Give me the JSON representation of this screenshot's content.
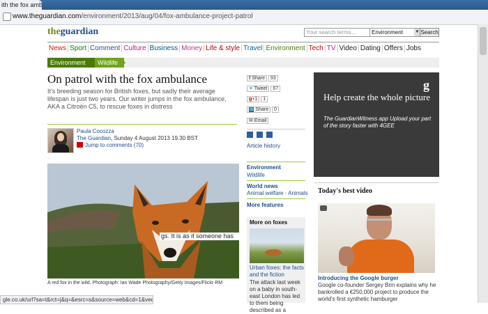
{
  "browser": {
    "tab_title": "ith the fox amb",
    "url_host": "www.theguardian.com",
    "url_path": "/environment/2013/aug/04/fox-ambulance-project-patrol",
    "status_url": "gle.co.uk/url?sa=t&rct=j&q=&esrc=s&source=web&cd=1&ved=..."
  },
  "header": {
    "logo_the": "the",
    "logo_guardian": "guardian",
    "search_placeholder": "Your search terms...",
    "search_scope": "Environment",
    "search_button": "Search"
  },
  "nav": {
    "items": [
      {
        "label": "News",
        "color": "#d61d00"
      },
      {
        "label": "Sport",
        "color": "#008000"
      },
      {
        "label": "Comment",
        "color": "#2a4d8a"
      },
      {
        "label": "Culture",
        "color": "#b51e84"
      },
      {
        "label": "Business",
        "color": "#005689"
      },
      {
        "label": "Money",
        "color": "#bb3b80"
      },
      {
        "label": "Life & style",
        "color": "#b80000"
      },
      {
        "label": "Travel",
        "color": "#0061a6"
      },
      {
        "label": "Environment",
        "color": "#4a7a00"
      },
      {
        "label": "Tech",
        "color": "#c80000"
      },
      {
        "label": "TV",
        "color": "#b51e84"
      },
      {
        "label": "Video",
        "color": "#222222"
      },
      {
        "label": "Dating",
        "color": "#222222"
      },
      {
        "label": "Offers",
        "color": "#222222"
      },
      {
        "label": "Jobs",
        "color": "#222222"
      }
    ]
  },
  "breadcrumb": {
    "level1": "Environment",
    "level2": "Wildlife"
  },
  "article": {
    "headline": "On patrol with the fox ambulance",
    "standfirst": "It's breeding season for British foxes, but sadly their average lifespan is just two years. Our writer jumps in the fox ambulance, AKA a Citroën C5, to rescue foxes in distress",
    "author": "Paula Cocozza",
    "source": "The Guardian",
    "date": ", Sunday 4 August 2013 19.30 BST",
    "comments_link": "Jump to comments (70)",
    "caption": "A red fox in the wild. Photograph: Ian Wade Photography/Getty Images/Flickr RM",
    "body_fragment": "gs. It is as if someone has"
  },
  "share": {
    "facebook": {
      "label": "Share",
      "count": "93"
    },
    "twitter": {
      "label": "Tweet",
      "count": "67"
    },
    "gplus": {
      "label": "+1",
      "count": "1"
    },
    "linkedin": {
      "label": "Share",
      "count": "0"
    },
    "email": "Email",
    "article_history": "Article history"
  },
  "related": {
    "environment": "Environment",
    "wildlife": "Wildlife",
    "world_news": "World news",
    "world_sub_1": "Animal welfare",
    "world_sub_sep": " · ",
    "world_sub_2": "Animals",
    "more_features": "More features"
  },
  "more_on_foxes": {
    "title": "More on foxes",
    "link": "Urban foxes: the facts and the fiction",
    "text": "The attack last week on a baby in south-east London has led to them being described as a"
  },
  "ad": {
    "logo": "g",
    "headline": "Help create the whole picture",
    "sub": "The GuardianWitness app Upload your part of the story faster with 4GEE"
  },
  "best_video": {
    "title": "Today's best video",
    "link": "Introducing the Google burger",
    "desc": "Google co-founder Sergey Brin explains why he bankrolled a €250,000 project to produce the world's first synthetic hamburger"
  }
}
